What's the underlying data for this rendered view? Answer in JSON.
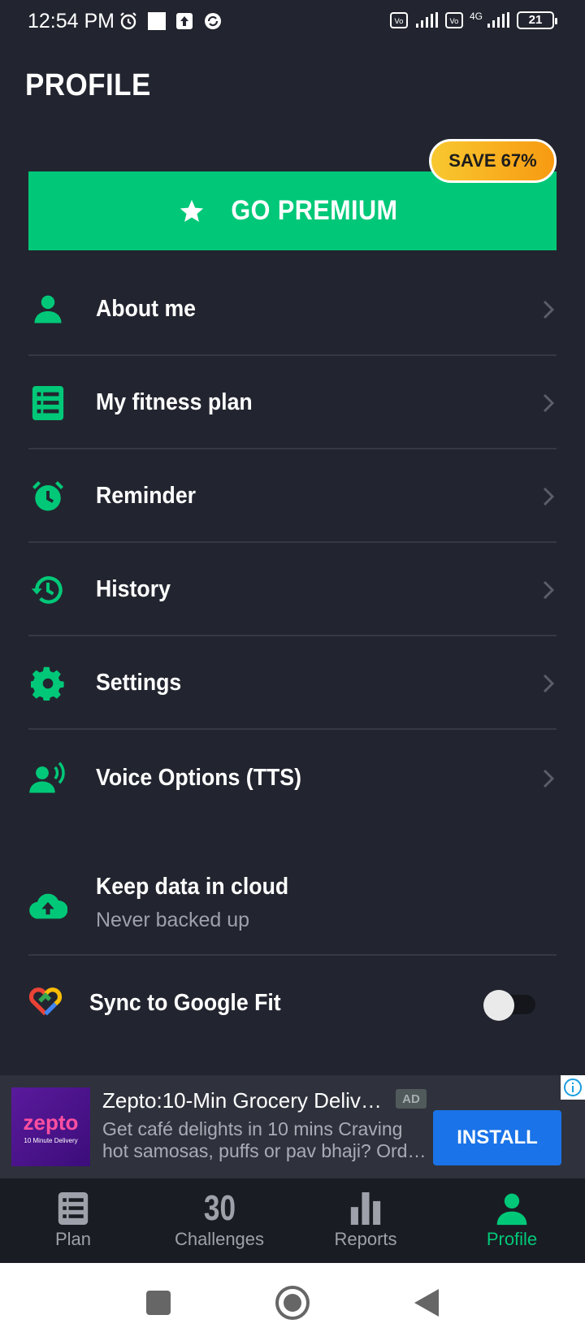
{
  "status_bar": {
    "time": "12:54 PM",
    "battery": "21",
    "network": "4G"
  },
  "header": {
    "title": "PROFILE"
  },
  "premium": {
    "label": "GO PREMIUM",
    "badge": "SAVE 67%"
  },
  "menu": {
    "items": [
      {
        "label": "About me",
        "icon": "person-icon"
      },
      {
        "label": "My fitness plan",
        "icon": "list-icon"
      },
      {
        "label": "Reminder",
        "icon": "alarm-icon"
      },
      {
        "label": "History",
        "icon": "history-icon"
      },
      {
        "label": "Settings",
        "icon": "gear-icon"
      },
      {
        "label": "Voice Options (TTS)",
        "icon": "voice-icon"
      }
    ]
  },
  "cloud": {
    "title": "Keep data in cloud",
    "subtitle": "Never backed up"
  },
  "google_fit": {
    "label": "Sync to Google Fit",
    "enabled": false
  },
  "ad": {
    "logo_name": "zepto",
    "logo_tagline": "10 Minute Delivery",
    "title": "Zepto:10-Min Grocery Deliv…",
    "badge": "AD",
    "description": "Get café delights in 10 mins Craving hot samosas, puffs or pav bhaji? Ord…",
    "install_label": "INSTALL"
  },
  "bottom_nav": {
    "tabs": [
      {
        "label": "Plan"
      },
      {
        "label": "Challenges",
        "number": "30"
      },
      {
        "label": "Reports"
      },
      {
        "label": "Profile"
      }
    ],
    "active": "Profile"
  },
  "colors": {
    "background": "#22252f",
    "accent": "#00c878",
    "badge_gradient_start": "#f8c830",
    "badge_gradient_end": "#f79a12",
    "install_button": "#1a73e8"
  }
}
